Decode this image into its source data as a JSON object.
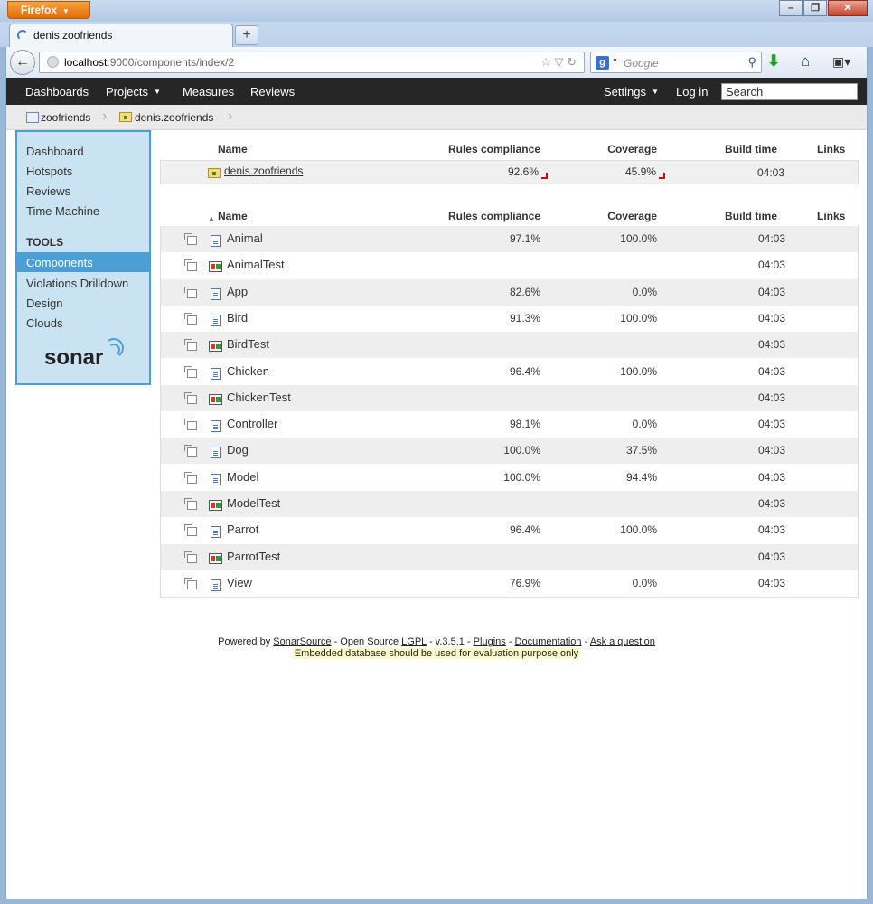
{
  "browser": {
    "app_button": "Firefox",
    "tab_title": "denis.zoofriends",
    "url_host": "localhost",
    "url_path": ":9000/components/index/2",
    "search_engine_placeholder": "Google"
  },
  "nav": {
    "dashboards": "Dashboards",
    "projects": "Projects",
    "measures": "Measures",
    "reviews": "Reviews",
    "settings": "Settings",
    "login": "Log in",
    "search_placeholder": "Search"
  },
  "breadcrumb": [
    "zoofriends",
    "denis.zoofriends"
  ],
  "sidebar": {
    "items": [
      "Dashboard",
      "Hotspots",
      "Reviews",
      "Time Machine"
    ],
    "tools_heading": "TOOLS",
    "tools": [
      "Components",
      "Violations Drilldown",
      "Design",
      "Clouds"
    ],
    "active": "Components",
    "logo": "sonar"
  },
  "project_table": {
    "headers": {
      "name": "Name",
      "rules": "Rules compliance",
      "coverage": "Coverage",
      "build": "Build time",
      "links": "Links"
    },
    "row": {
      "name": "denis.zoofriends",
      "rules": "92.6%",
      "coverage": "45.9%",
      "build": "04:03"
    }
  },
  "components_table": {
    "headers": {
      "name": "Name",
      "rules": "Rules compliance",
      "coverage": "Coverage",
      "build": "Build time",
      "links": "Links"
    },
    "rows": [
      {
        "name": "Animal",
        "type": "file",
        "rules": "97.1%",
        "coverage": "100.0%",
        "build": "04:03"
      },
      {
        "name": "AnimalTest",
        "type": "test",
        "rules": "",
        "coverage": "",
        "build": "04:03"
      },
      {
        "name": "App",
        "type": "file",
        "rules": "82.6%",
        "coverage": "0.0%",
        "build": "04:03"
      },
      {
        "name": "Bird",
        "type": "file",
        "rules": "91.3%",
        "coverage": "100.0%",
        "build": "04:03"
      },
      {
        "name": "BirdTest",
        "type": "test",
        "rules": "",
        "coverage": "",
        "build": "04:03"
      },
      {
        "name": "Chicken",
        "type": "file",
        "rules": "96.4%",
        "coverage": "100.0%",
        "build": "04:03"
      },
      {
        "name": "ChickenTest",
        "type": "test",
        "rules": "",
        "coverage": "",
        "build": "04:03"
      },
      {
        "name": "Controller",
        "type": "file",
        "rules": "98.1%",
        "coverage": "0.0%",
        "build": "04:03"
      },
      {
        "name": "Dog",
        "type": "file",
        "rules": "100.0%",
        "coverage": "37.5%",
        "build": "04:03"
      },
      {
        "name": "Model",
        "type": "file",
        "rules": "100.0%",
        "coverage": "94.4%",
        "build": "04:03"
      },
      {
        "name": "ModelTest",
        "type": "test",
        "rules": "",
        "coverage": "",
        "build": "04:03"
      },
      {
        "name": "Parrot",
        "type": "file",
        "rules": "96.4%",
        "coverage": "100.0%",
        "build": "04:03"
      },
      {
        "name": "ParrotTest",
        "type": "test",
        "rules": "",
        "coverage": "",
        "build": "04:03"
      },
      {
        "name": "View",
        "type": "file",
        "rules": "76.9%",
        "coverage": "0.0%",
        "build": "04:03"
      }
    ]
  },
  "footer": {
    "powered_by": "Powered by",
    "sonarsource": "SonarSource",
    "open_source": "- Open Source",
    "lgpl": "LGPL",
    "version": "- v.3.5.1 -",
    "plugins": "Plugins",
    "sep1": "-",
    "documentation": "Documentation",
    "sep2": "-",
    "ask": "Ask a question",
    "warning": "Embedded database should be used for evaluation purpose only"
  },
  "colors": {
    "accent": "#4b9fd5",
    "nav_bg": "#262626",
    "sidebar_bg": "#cae3f2",
    "trend_down": "#dd0000"
  }
}
